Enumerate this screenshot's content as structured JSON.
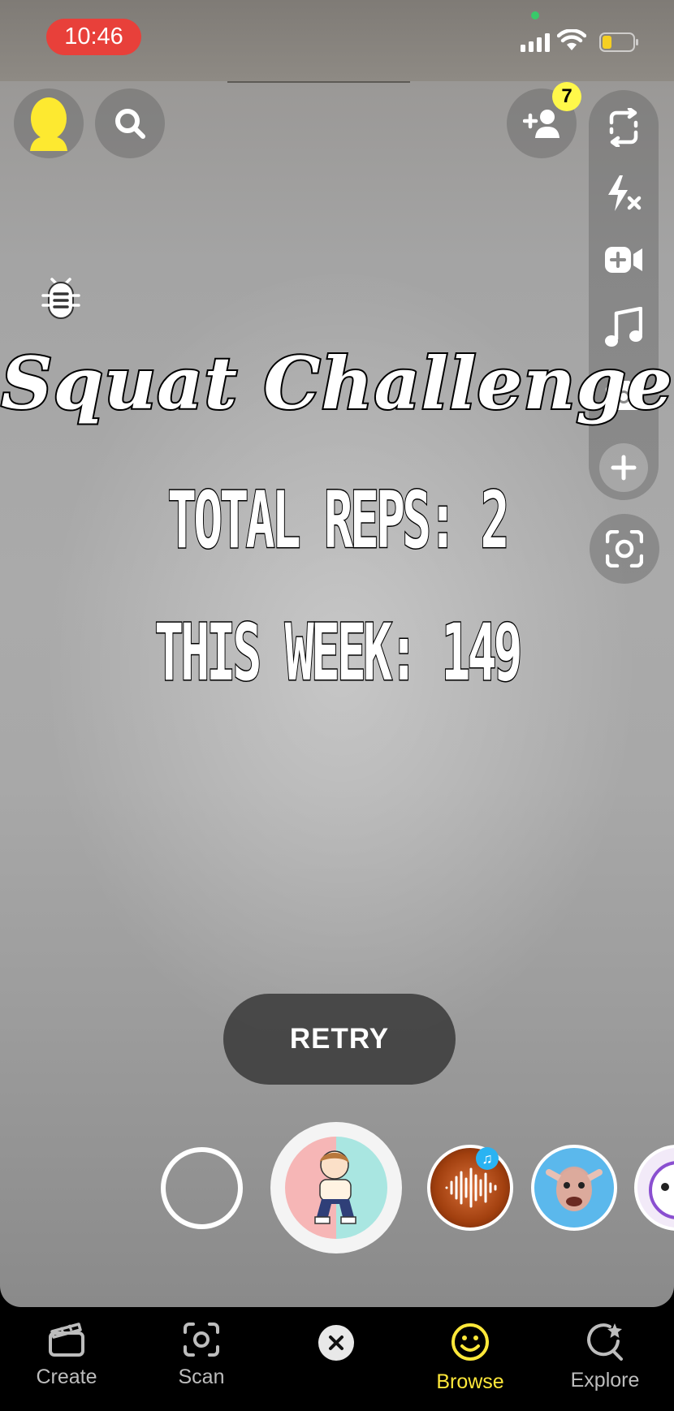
{
  "status_bar": {
    "time": "10:46"
  },
  "header": {
    "friend_requests_count": "7"
  },
  "lens": {
    "title": "Squat Challenge",
    "total_reps": "TOTAL REPS: 2",
    "this_week": "THIS WEEK: 149",
    "retry_label": "RETRY"
  },
  "bottom_nav": {
    "items": [
      {
        "label": "Create",
        "icon": "clapperboard-icon"
      },
      {
        "label": "Scan",
        "icon": "scan-icon"
      },
      {
        "label": "Browse",
        "icon": "smiley-icon",
        "active": true
      },
      {
        "label": "Explore",
        "icon": "explore-icon"
      }
    ]
  },
  "colors": {
    "time_pill": "#e8403a",
    "badge": "#fff84a",
    "active_nav": "#ffe83a",
    "avatar": "#fde930"
  }
}
